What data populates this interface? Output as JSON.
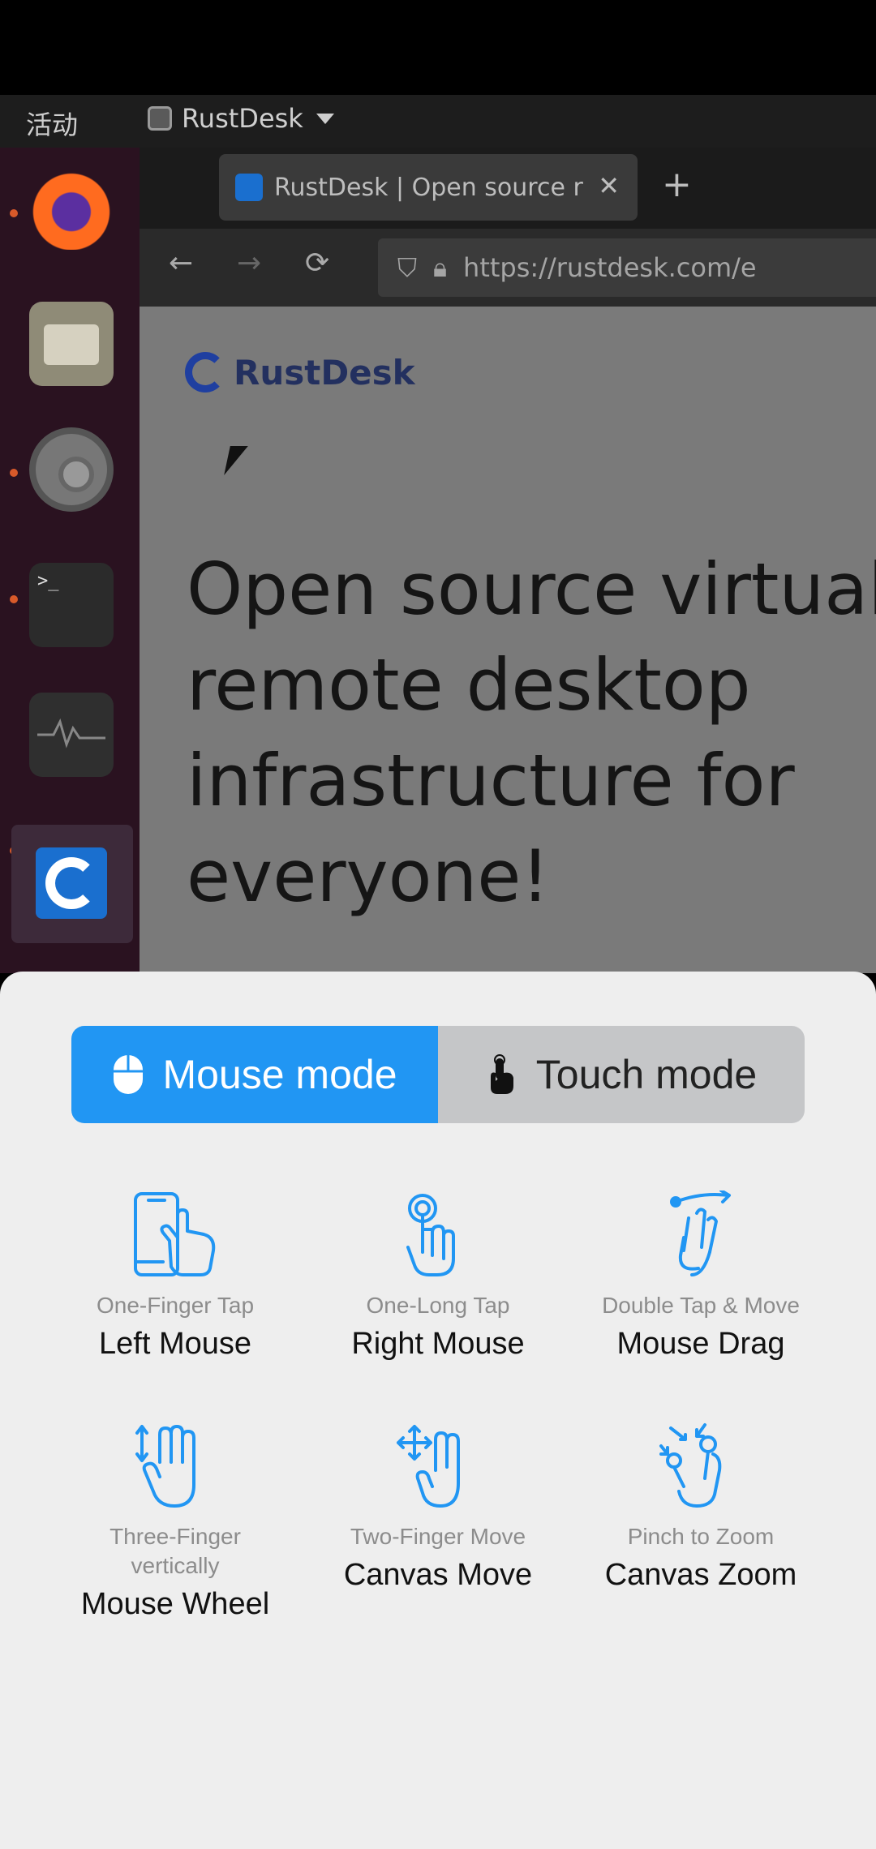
{
  "remote": {
    "topbar": {
      "activities": "活动",
      "app_name": "RustDesk"
    },
    "terminal_prompt": ">_",
    "browser": {
      "tab_title": "RustDesk | Open source r",
      "url": "https://rustdesk.com/e",
      "brand": "RustDesk",
      "headline": [
        "Open source virtual",
        "remote desktop",
        "infrastructure for",
        "everyone!"
      ]
    }
  },
  "modes": {
    "mouse_label": "Mouse mode",
    "touch_label": "Touch mode",
    "active": "mouse"
  },
  "gestures": [
    {
      "icon": "phone-tap-icon",
      "description": "One-Finger Tap",
      "title": "Left Mouse"
    },
    {
      "icon": "long-tap-icon",
      "description": "One-Long Tap",
      "title": "Right Mouse"
    },
    {
      "icon": "double-tap-move-icon",
      "description": "Double Tap & Move",
      "title": "Mouse Drag"
    },
    {
      "icon": "three-finger-icon",
      "description": "Three-Finger vertically",
      "title": "Mouse Wheel"
    },
    {
      "icon": "two-finger-move-icon",
      "description": "Two-Finger Move",
      "title": "Canvas Move"
    },
    {
      "icon": "pinch-zoom-icon",
      "description": "Pinch to Zoom",
      "title": "Canvas Zoom"
    }
  ],
  "colors": {
    "accent": "#2196f3",
    "sheet_bg": "#eeeeee"
  }
}
